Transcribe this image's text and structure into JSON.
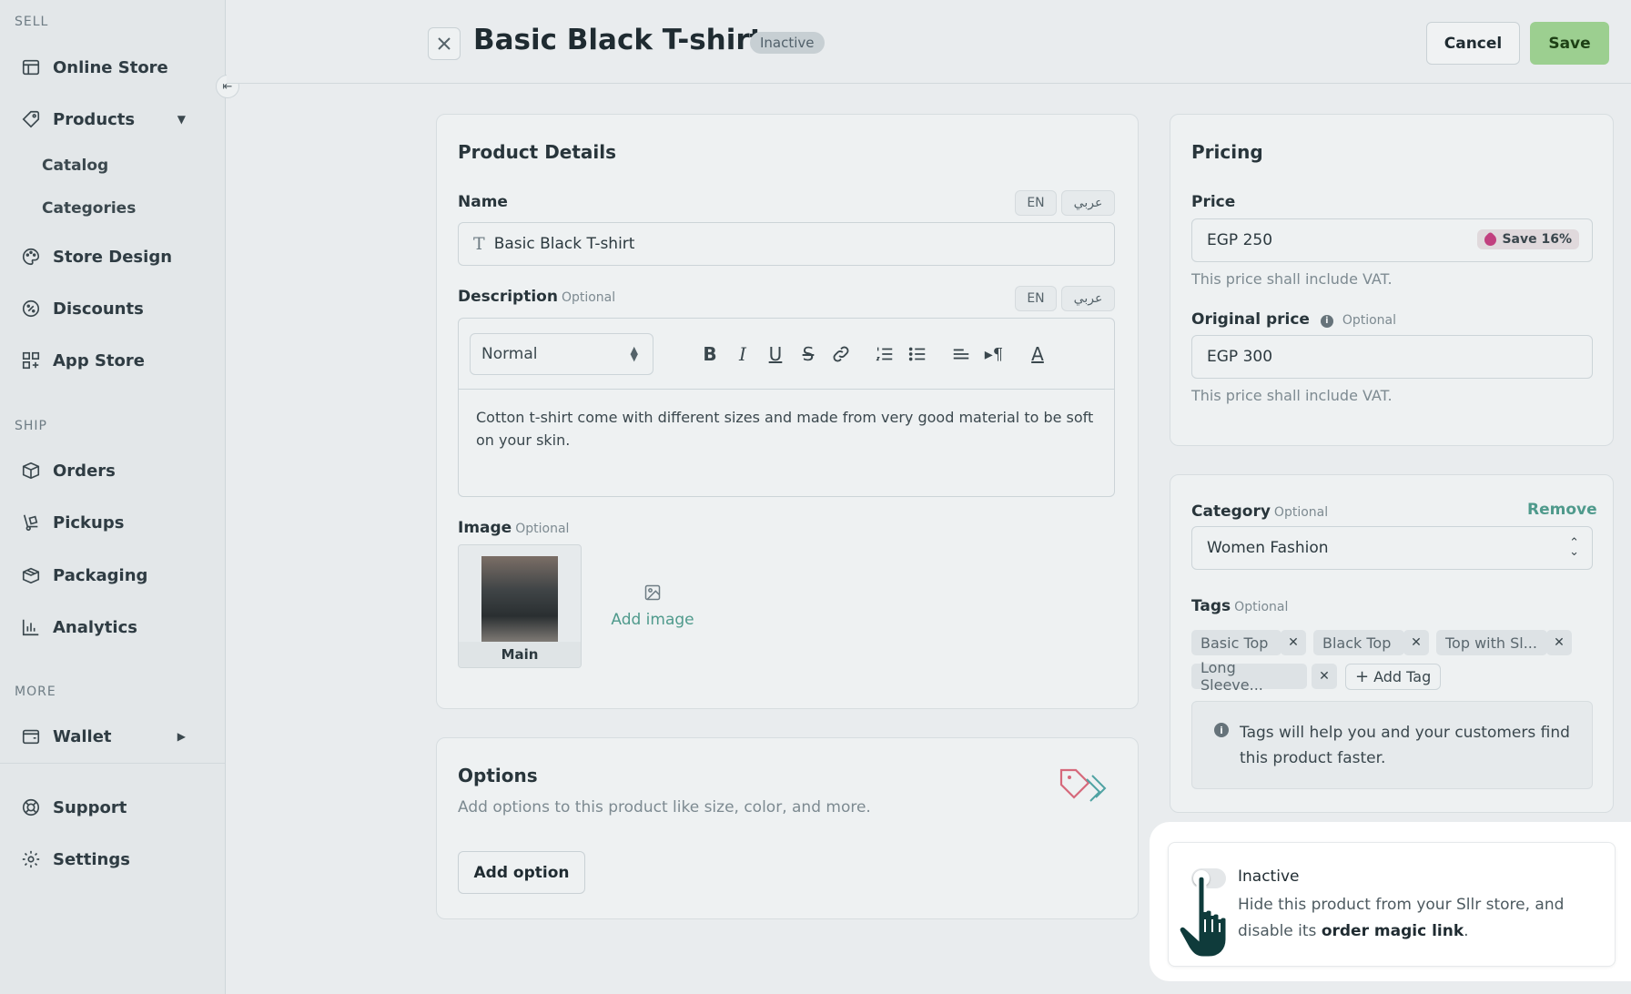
{
  "sidebar": {
    "sections": {
      "sell": "SELL",
      "ship": "SHIP",
      "more": "MORE"
    },
    "items": {
      "online_store": "Online Store",
      "products": "Products",
      "catalog": "Catalog",
      "categories": "Categories",
      "store_design": "Store Design",
      "discounts": "Discounts",
      "app_store": "App Store",
      "orders": "Orders",
      "pickups": "Pickups",
      "packaging": "Packaging",
      "analytics": "Analytics",
      "wallet": "Wallet",
      "support": "Support",
      "settings": "Settings"
    }
  },
  "header": {
    "title": "Basic Black T-shirt",
    "status_badge": "Inactive",
    "cancel_label": "Cancel",
    "save_label": "Save"
  },
  "product_details": {
    "title": "Product Details",
    "name_label": "Name",
    "lang_en": "EN",
    "lang_ar": "عربي",
    "name_value": "Basic Black T-shirt",
    "description_label": "Description",
    "optional": "Optional",
    "format_select": "Normal",
    "description_text": "Cotton t-shirt come with different sizes and made from very good material to be soft on your skin.",
    "image_label": "Image",
    "main_image_caption": "Main",
    "add_image_label": "Add image"
  },
  "options": {
    "title": "Options",
    "subtitle": "Add options to this product like size, color, and more.",
    "add_option_label": "Add option"
  },
  "pricing": {
    "title": "Pricing",
    "price_label": "Price",
    "price_value": "EGP 250",
    "save_chip": "Save 16%",
    "price_helper": "This price shall include VAT.",
    "original_price_label": "Original price",
    "optional": "Optional",
    "original_price_value": "EGP 300",
    "original_helper": "This price shall include VAT."
  },
  "category": {
    "label": "Category",
    "optional": "Optional",
    "remove_label": "Remove",
    "value": "Women Fashion",
    "tags_label": "Tags",
    "tags": [
      "Basic Top",
      "Black Top",
      "Top with Sl...",
      "Long Sleeve..."
    ],
    "add_tag_label": "Add Tag",
    "info_text": "Tags will help you and your customers find this product faster."
  },
  "visibility": {
    "title": "Inactive",
    "desc_prefix": "Hide this product from your Sllr store, and disable its",
    "desc_link": "order magic link",
    "desc_suffix": "."
  },
  "colors": {
    "accent": "#4f9a8c",
    "save_button": "#9ccf90",
    "tag_icon": "#c1407f"
  }
}
